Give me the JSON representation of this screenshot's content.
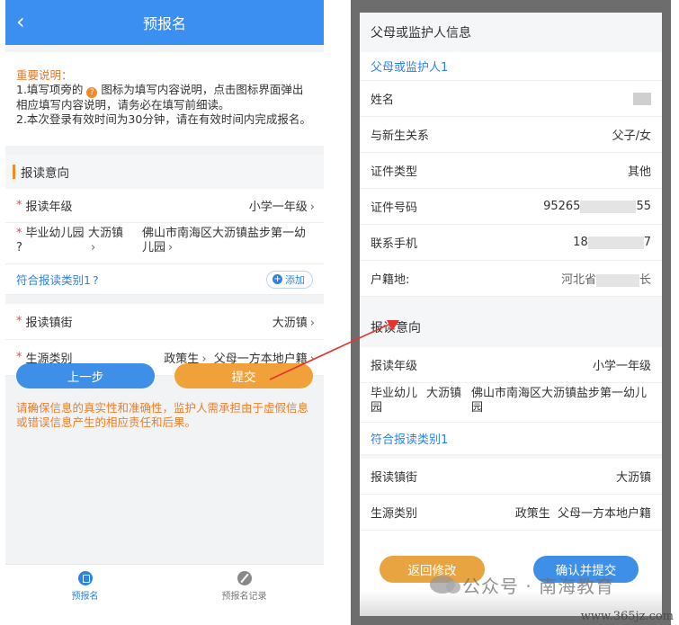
{
  "left": {
    "header": {
      "title": "预报名",
      "back": "‹"
    },
    "notice": {
      "title": "重要说明：",
      "line1_a": "1.填写项旁的",
      "line1_icon": "?",
      "line1_b": "图标为填写内容说明，点击图标界面弹出相应填写内容说明，请务必在填写前细读。",
      "line2": "2.本次登录有效时间为30分钟，请在有效时间内完成报名。"
    },
    "section": "报读意向",
    "rows": {
      "grade": {
        "label": "报读年级",
        "value": "小学一年级"
      },
      "kindergarten": {
        "label": "毕业幼儿园",
        "town": "大沥镇",
        "name": "佛山市南海区大沥镇盐步第一幼儿园"
      },
      "category": {
        "label": "符合报读类别1",
        "add": "添加"
      },
      "street": {
        "label": "报读镇街",
        "value": "大沥镇"
      },
      "source": {
        "label": "生源类别",
        "value1": "政策生",
        "value2": "父母一方本地户籍"
      }
    },
    "buttons": {
      "prev": "上一步",
      "submit": "提交"
    },
    "disclaimer": "请确保信息的真实性和准确性，监护人需承担由于虚假信息或错误信息产生的相应责任和后果。",
    "tabs": [
      {
        "label": "预报名",
        "icon": "form-icon"
      },
      {
        "label": "预报名记录",
        "icon": "pen-icon"
      }
    ]
  },
  "right": {
    "guardian_section": "父母或监护人信息",
    "guardian_sub": "父母或监护人1",
    "guardian_rows": {
      "name": {
        "label": "姓名"
      },
      "relation": {
        "label": "与新生关系",
        "value": "父子/女"
      },
      "id_type": {
        "label": "证件类型",
        "value": "其他"
      },
      "id_number": {
        "label": "证件号码",
        "prefix": "95265",
        "suffix": "55"
      },
      "phone": {
        "label": "联系手机",
        "prefix": "18",
        "suffix": "7"
      },
      "household": {
        "label": "户籍地:",
        "prefix": "河北省",
        "suffix": "长"
      }
    },
    "intent_section": "报读意向",
    "intent_rows": {
      "grade": {
        "label": "报读年级",
        "value": "小学一年级"
      },
      "kindergarten": {
        "label": "毕业幼儿园",
        "town": "大沥镇",
        "name": "佛山市南海区大沥镇盐步第一幼儿园"
      },
      "category": {
        "label": "符合报读类别1"
      },
      "street": {
        "label": "报读镇街",
        "value": "大沥镇"
      },
      "source": {
        "label": "生源类别",
        "value1": "政策生",
        "value2": "父母一方本地户籍"
      }
    },
    "buttons": {
      "back": "返回修改",
      "confirm": "确认并提交"
    }
  },
  "watermark": "公众号 · 南海教育",
  "site": "www.365jz.com",
  "colors": {
    "primary": "#3b8ff0",
    "accent": "#f28a2c",
    "link": "#2d82e6",
    "arrow": "#e8322b"
  }
}
